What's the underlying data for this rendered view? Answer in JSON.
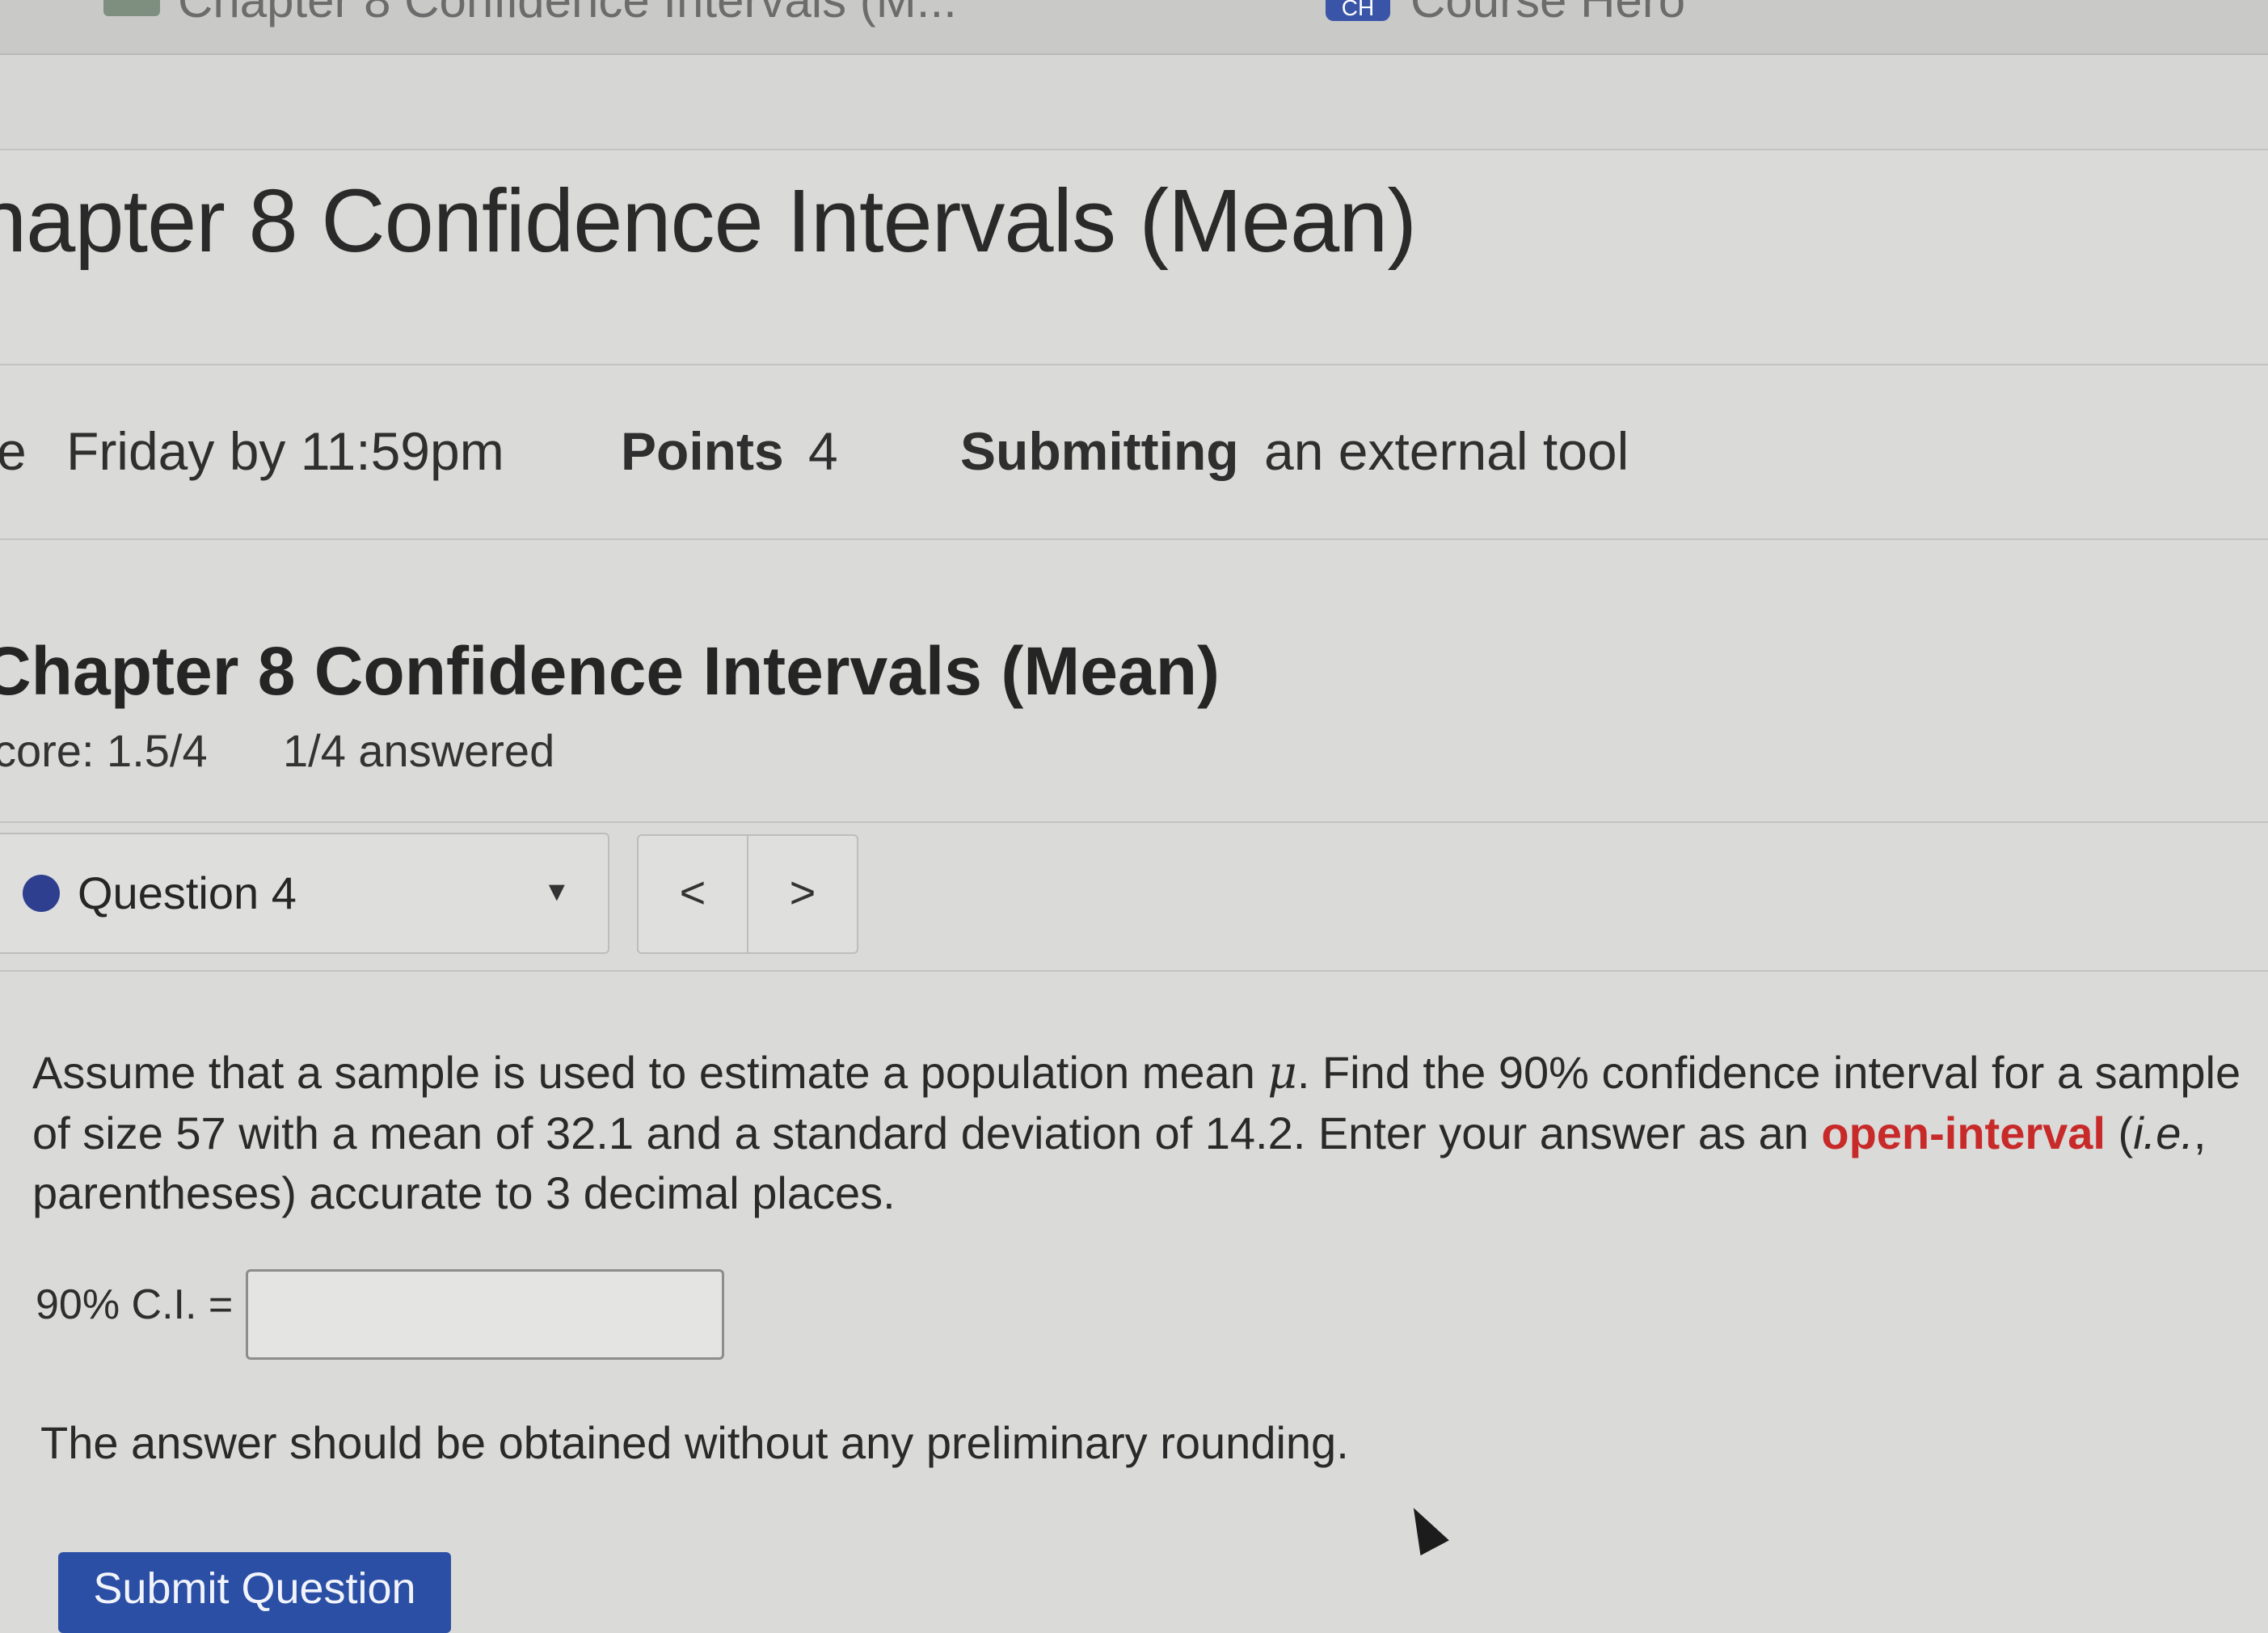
{
  "browser": {
    "tab_title": "Chapter 8 Confidence Intervals (M...",
    "right_tab_title": "Course Hero",
    "right_tab_icon": "CH"
  },
  "page": {
    "title": "hapter 8 Confidence Intervals (Mean)"
  },
  "meta": {
    "due_prefix": "e",
    "due_value": "Friday by 11:59pm",
    "points_label": "Points",
    "points_value": "4",
    "submitting_label": "Submitting",
    "submitting_value": "an external tool"
  },
  "quiz": {
    "title": "Chapter 8 Confidence Intervals (Mean)",
    "score": "core: 1.5/4",
    "answered": "1/4 answered"
  },
  "question_nav": {
    "selected": "Question 4",
    "prev_symbol": "<",
    "next_symbol": ">",
    "status_color": "#2d3f8e"
  },
  "question": {
    "line1_a": "Assume that a sample is used to estimate a population mean ",
    "mu_symbol": "μ",
    "line1_b": ". Find the 90% confidence interval for a sample",
    "line2_a": "of size 57 with a mean of 32.1 and a standard deviation of 14.2. Enter your answer as an ",
    "open_interval": "open-interval",
    "line2_b": " (",
    "ie": "i.e.",
    "line2_c": ",",
    "line3": "parentheses) accurate to 3 decimal places.",
    "ci_label": "90% C.I. =",
    "ci_value": "",
    "note": "The answer should be obtained without any preliminary rounding."
  },
  "actions": {
    "submit_label": "Submit Question",
    "submit_color": "#2b4fa4"
  }
}
